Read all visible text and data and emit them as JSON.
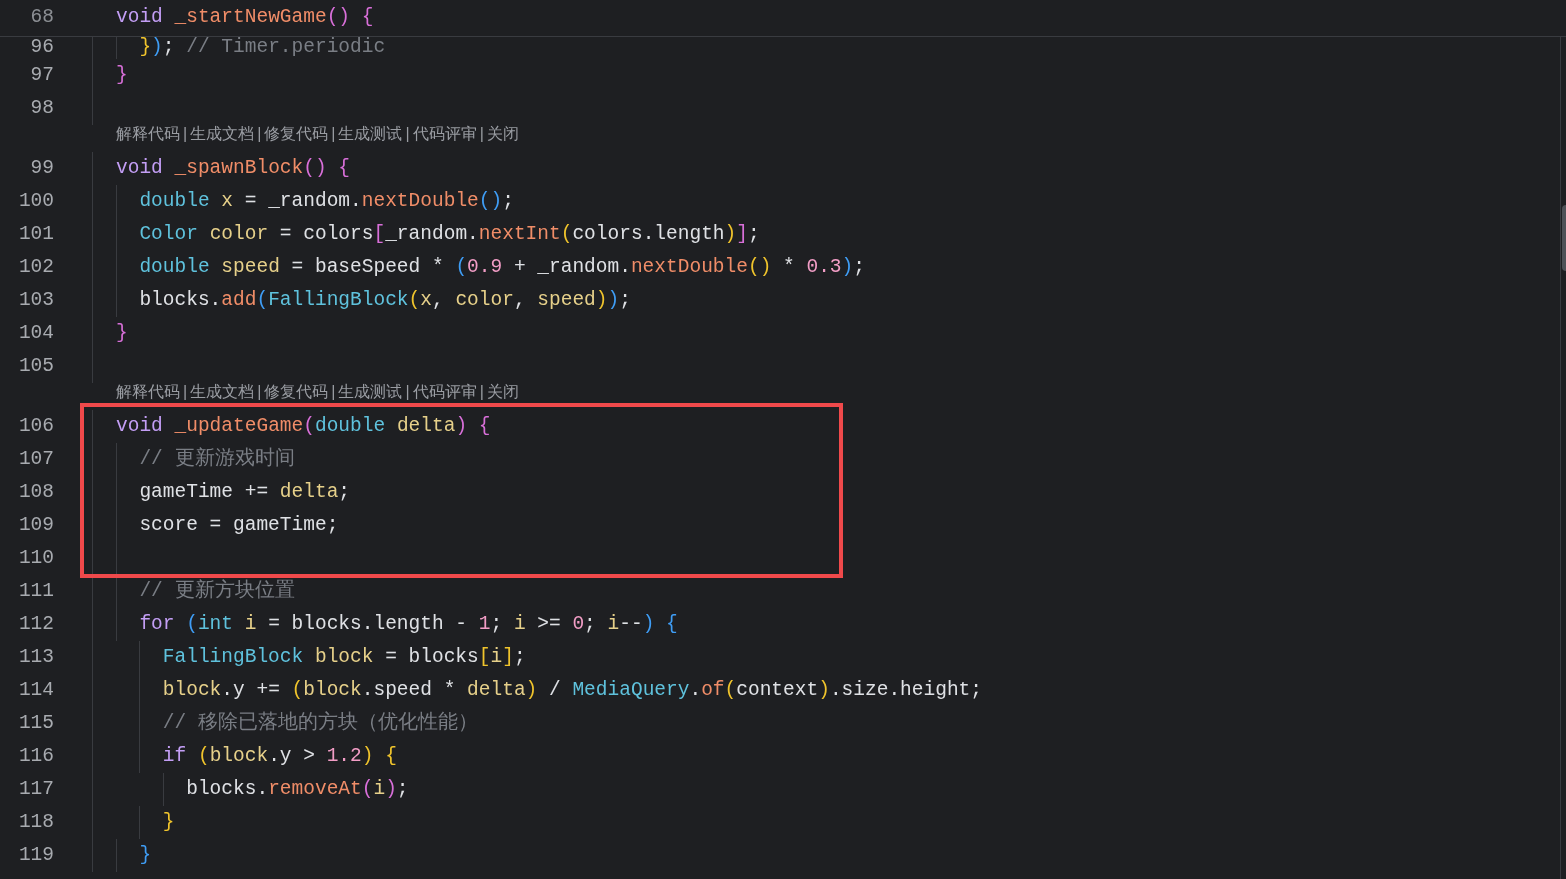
{
  "sticky_line": {
    "number": "68",
    "tokens": [
      {
        "kind": "keyword",
        "t": "void "
      },
      {
        "kind": "function",
        "t": "_startNewGame"
      },
      {
        "kind": "bracket1",
        "t": "() {"
      }
    ]
  },
  "rows": [
    {
      "kind": "code",
      "number": "96",
      "tokens": [
        {
          "kind": "bracket2",
          "t": "  }"
        },
        {
          "kind": "bracket3",
          "t": ")"
        },
        {
          "kind": "plain",
          "t": ";"
        },
        {
          "kind": "comment",
          "t": " // Timer.periodic"
        }
      ]
    },
    {
      "kind": "code",
      "number": "97",
      "tokens": [
        {
          "kind": "bracket1",
          "t": "}"
        }
      ]
    },
    {
      "kind": "code",
      "number": "98"
    },
    {
      "kind": "lens",
      "actions": [
        "解释代码",
        "生成文档",
        "修复代码",
        "生成测试",
        "代码评审",
        "关闭"
      ],
      "separator": "|"
    },
    {
      "kind": "code",
      "number": "99",
      "tokens": [
        {
          "kind": "keyword",
          "t": "void "
        },
        {
          "kind": "function",
          "t": "_spawnBlock"
        },
        {
          "kind": "bracket1",
          "t": "() {"
        }
      ]
    },
    {
      "kind": "code",
      "number": "100",
      "tokens": [
        {
          "kind": "type",
          "t": "  double "
        },
        {
          "kind": "variable",
          "t": "x"
        },
        {
          "kind": "plain",
          "t": " = _random."
        },
        {
          "kind": "function",
          "t": "nextDouble"
        },
        {
          "kind": "bracket3",
          "t": "()"
        },
        {
          "kind": "plain",
          "t": ";"
        }
      ]
    },
    {
      "kind": "code",
      "number": "101",
      "tokens": [
        {
          "kind": "type",
          "t": "  Color "
        },
        {
          "kind": "variable",
          "t": "color"
        },
        {
          "kind": "plain",
          "t": " = colors"
        },
        {
          "kind": "bracket1",
          "t": "["
        },
        {
          "kind": "plain",
          "t": "_random."
        },
        {
          "kind": "function",
          "t": "nextInt"
        },
        {
          "kind": "bracket2",
          "t": "("
        },
        {
          "kind": "plain",
          "t": "colors.length"
        },
        {
          "kind": "bracket2",
          "t": ")"
        },
        {
          "kind": "bracket1",
          "t": "]"
        },
        {
          "kind": "plain",
          "t": ";"
        }
      ]
    },
    {
      "kind": "code",
      "number": "102",
      "tokens": [
        {
          "kind": "type",
          "t": "  double "
        },
        {
          "kind": "variable",
          "t": "speed"
        },
        {
          "kind": "plain",
          "t": " = baseSpeed * "
        },
        {
          "kind": "bracket3",
          "t": "("
        },
        {
          "kind": "number",
          "t": "0.9"
        },
        {
          "kind": "plain",
          "t": " + _random."
        },
        {
          "kind": "function",
          "t": "nextDouble"
        },
        {
          "kind": "bracket2",
          "t": "()"
        },
        {
          "kind": "plain",
          "t": " * "
        },
        {
          "kind": "number",
          "t": "0.3"
        },
        {
          "kind": "bracket3",
          "t": ")"
        },
        {
          "kind": "plain",
          "t": ";"
        }
      ]
    },
    {
      "kind": "code",
      "number": "103",
      "tokens": [
        {
          "kind": "plain",
          "t": "  blocks."
        },
        {
          "kind": "function",
          "t": "add"
        },
        {
          "kind": "bracket3",
          "t": "("
        },
        {
          "kind": "type",
          "t": "FallingBlock"
        },
        {
          "kind": "bracket2",
          "t": "("
        },
        {
          "kind": "variable",
          "t": "x"
        },
        {
          "kind": "plain",
          "t": ", "
        },
        {
          "kind": "variable",
          "t": "color"
        },
        {
          "kind": "plain",
          "t": ", "
        },
        {
          "kind": "variable",
          "t": "speed"
        },
        {
          "kind": "bracket2",
          "t": ")"
        },
        {
          "kind": "bracket3",
          "t": ")"
        },
        {
          "kind": "plain",
          "t": ";"
        }
      ]
    },
    {
      "kind": "code",
      "number": "104",
      "tokens": [
        {
          "kind": "bracket1",
          "t": "}"
        }
      ]
    },
    {
      "kind": "code",
      "number": "105"
    },
    {
      "kind": "lens",
      "actions": [
        "解释代码",
        "生成文档",
        "修复代码",
        "生成测试",
        "代码评审",
        "关闭"
      ],
      "separator": "|"
    },
    {
      "kind": "code",
      "number": "106",
      "tokens": [
        {
          "kind": "keyword",
          "t": "void "
        },
        {
          "kind": "function",
          "t": "_updateGame"
        },
        {
          "kind": "bracket1",
          "t": "("
        },
        {
          "kind": "type",
          "t": "double "
        },
        {
          "kind": "variable",
          "t": "delta"
        },
        {
          "kind": "bracket1",
          "t": ") {"
        }
      ]
    },
    {
      "kind": "code",
      "number": "107",
      "tokens": [
        {
          "kind": "comment",
          "t": "  // 更新游戏时间"
        }
      ]
    },
    {
      "kind": "code",
      "number": "108",
      "tokens": [
        {
          "kind": "plain",
          "t": "  gameTime += "
        },
        {
          "kind": "variable",
          "t": "delta"
        },
        {
          "kind": "plain",
          "t": ";"
        }
      ]
    },
    {
      "kind": "code",
      "number": "109",
      "tokens": [
        {
          "kind": "plain",
          "t": "  score = gameTime;"
        }
      ]
    },
    {
      "kind": "code",
      "number": "110"
    },
    {
      "kind": "code",
      "number": "111",
      "tokens": [
        {
          "kind": "comment",
          "t": "  // 更新方块位置"
        }
      ]
    },
    {
      "kind": "code",
      "number": "112",
      "tokens": [
        {
          "kind": "keyword",
          "t": "  for "
        },
        {
          "kind": "bracket3",
          "t": "("
        },
        {
          "kind": "type",
          "t": "int "
        },
        {
          "kind": "variable",
          "t": "i"
        },
        {
          "kind": "plain",
          "t": " = blocks.length - "
        },
        {
          "kind": "number",
          "t": "1"
        },
        {
          "kind": "plain",
          "t": "; "
        },
        {
          "kind": "variable",
          "t": "i"
        },
        {
          "kind": "plain",
          "t": " >= "
        },
        {
          "kind": "number",
          "t": "0"
        },
        {
          "kind": "plain",
          "t": "; "
        },
        {
          "kind": "variable",
          "t": "i"
        },
        {
          "kind": "plain",
          "t": "--"
        },
        {
          "kind": "bracket3",
          "t": ") {"
        }
      ]
    },
    {
      "kind": "code",
      "number": "113",
      "tokens": [
        {
          "kind": "type",
          "t": "    FallingBlock "
        },
        {
          "kind": "variable",
          "t": "block"
        },
        {
          "kind": "plain",
          "t": " = blocks"
        },
        {
          "kind": "bracket2",
          "t": "["
        },
        {
          "kind": "variable",
          "t": "i"
        },
        {
          "kind": "bracket2",
          "t": "]"
        },
        {
          "kind": "plain",
          "t": ";"
        }
      ]
    },
    {
      "kind": "code",
      "number": "114",
      "tokens": [
        {
          "kind": "variable",
          "t": "    block"
        },
        {
          "kind": "plain",
          "t": ".y += "
        },
        {
          "kind": "bracket2",
          "t": "("
        },
        {
          "kind": "variable",
          "t": "block"
        },
        {
          "kind": "plain",
          "t": ".speed * "
        },
        {
          "kind": "variable",
          "t": "delta"
        },
        {
          "kind": "bracket2",
          "t": ")"
        },
        {
          "kind": "plain",
          "t": " / "
        },
        {
          "kind": "type",
          "t": "MediaQuery"
        },
        {
          "kind": "plain",
          "t": "."
        },
        {
          "kind": "function",
          "t": "of"
        },
        {
          "kind": "bracket2",
          "t": "("
        },
        {
          "kind": "plain",
          "t": "context"
        },
        {
          "kind": "bracket2",
          "t": ")"
        },
        {
          "kind": "plain",
          "t": ".size.height;"
        }
      ]
    },
    {
      "kind": "code",
      "number": "115",
      "tokens": [
        {
          "kind": "comment",
          "t": "    // 移除已落地的方块（优化性能）"
        }
      ]
    },
    {
      "kind": "code",
      "number": "116",
      "tokens": [
        {
          "kind": "keyword",
          "t": "    if "
        },
        {
          "kind": "bracket2",
          "t": "("
        },
        {
          "kind": "variable",
          "t": "block"
        },
        {
          "kind": "plain",
          "t": ".y > "
        },
        {
          "kind": "number",
          "t": "1.2"
        },
        {
          "kind": "bracket2",
          "t": ") {"
        }
      ]
    },
    {
      "kind": "code",
      "number": "117",
      "tokens": [
        {
          "kind": "plain",
          "t": "      blocks."
        },
        {
          "kind": "function",
          "t": "removeAt"
        },
        {
          "kind": "bracket1",
          "t": "("
        },
        {
          "kind": "variable",
          "t": "i"
        },
        {
          "kind": "bracket1",
          "t": ")"
        },
        {
          "kind": "plain",
          "t": ";"
        }
      ]
    },
    {
      "kind": "code",
      "number": "118",
      "tokens": [
        {
          "kind": "bracket2",
          "t": "    }"
        }
      ]
    },
    {
      "kind": "code",
      "number": "119",
      "tokens": [
        {
          "kind": "bracket3",
          "t": "  }"
        }
      ]
    }
  ],
  "annotation": {
    "kind": "rectangle"
  }
}
